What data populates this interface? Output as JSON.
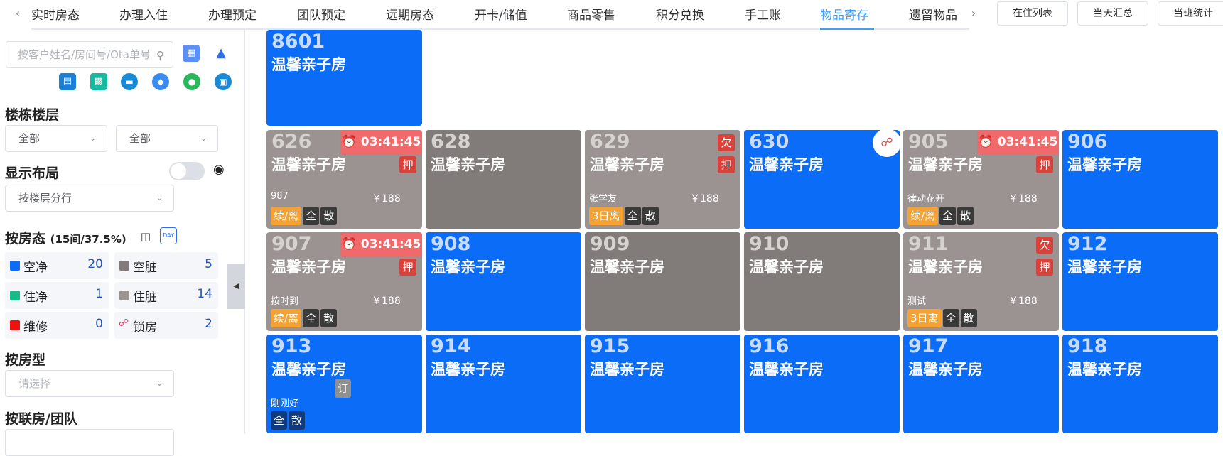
{
  "tabs": {
    "items": [
      "实时房态",
      "办理入住",
      "办理预定",
      "团队预定",
      "远期房态",
      "开卡/储值",
      "商品零售",
      "积分兑换",
      "手工账",
      "物品寄存",
      "遗留物品"
    ],
    "active": "物品寄存",
    "prev_arrow": "‹",
    "next_arrow": "›"
  },
  "header_buttons": [
    "在住列表",
    "当天汇总",
    "当班统计"
  ],
  "sidebar": {
    "search_placeholder": "按客户姓名/房间号/Ota单号",
    "building_title": "楼栋楼层",
    "building_select": "全部",
    "floor_select": "全部",
    "layout_title": "显示布局",
    "layout_select": "按楼层分行",
    "status_title": "按房态",
    "status_summary": "(15间/37.5%)",
    "status_cells": [
      {
        "label": "空净",
        "count": "20",
        "color": "#0b6cf7"
      },
      {
        "label": "空脏",
        "count": "5",
        "color": "#817b7a"
      },
      {
        "label": "住净",
        "count": "1",
        "color": "#1ab98a"
      },
      {
        "label": "住脏",
        "count": "14",
        "color": "#9a9391"
      },
      {
        "label": "维修",
        "count": "0",
        "color": "#ee1111"
      },
      {
        "label": "锁房",
        "count": "2",
        "color": ""
      }
    ],
    "roomtype_title": "按房型",
    "roomtype_placeholder": "请选择",
    "group_title": "按联房/团队"
  },
  "rooms": [
    {
      "number": "8601",
      "type": "温馨亲子房",
      "status": "blue"
    },
    {
      "number": "626",
      "type": "温馨亲子房",
      "status": "occ",
      "timer": "03:41:45",
      "badges": [
        "押"
      ],
      "guest": "987",
      "price": "￥188",
      "chips": [
        "续/离",
        "全",
        "散"
      ]
    },
    {
      "number": "628",
      "type": "温馨亲子房",
      "status": "dirty"
    },
    {
      "number": "629",
      "type": "温馨亲子房",
      "status": "occ",
      "badges": [
        "欠",
        "押"
      ],
      "guest": "张学友",
      "price": "￥188",
      "chips": [
        "3日离",
        "全",
        "散"
      ]
    },
    {
      "number": "630",
      "type": "温馨亲子房",
      "status": "blue",
      "locked": true
    },
    {
      "number": "905",
      "type": "温馨亲子房",
      "status": "occ",
      "timer": "03:41:45",
      "badges": [
        "押"
      ],
      "guest": "律动花开",
      "price": "￥188",
      "chips": [
        "续/离",
        "全",
        "散"
      ]
    },
    {
      "number": "906",
      "type": "温馨亲子房",
      "status": "blue"
    },
    {
      "number": "907",
      "type": "温馨亲子房",
      "status": "occ",
      "timer": "03:41:45",
      "badges": [
        "押"
      ],
      "guest": "按时到",
      "price": "￥188",
      "chips": [
        "续/离",
        "全",
        "散"
      ]
    },
    {
      "number": "908",
      "type": "温馨亲子房",
      "status": "blue"
    },
    {
      "number": "909",
      "type": "温馨亲子房",
      "status": "dirty"
    },
    {
      "number": "910",
      "type": "温馨亲子房",
      "status": "dirty"
    },
    {
      "number": "911",
      "type": "温馨亲子房",
      "status": "occ",
      "badges": [
        "欠",
        "押"
      ],
      "guest": "测试",
      "price": "￥188",
      "chips": [
        "3日离",
        "全",
        "散"
      ]
    },
    {
      "number": "912",
      "type": "温馨亲子房",
      "status": "blue"
    },
    {
      "number": "913",
      "type": "温馨亲子房",
      "status": "blue",
      "booked": "订",
      "guest": "刚刚好",
      "chips": [
        "全",
        "散"
      ]
    },
    {
      "number": "914",
      "type": "温馨亲子房",
      "status": "blue"
    },
    {
      "number": "915",
      "type": "温馨亲子房",
      "status": "blue"
    },
    {
      "number": "916",
      "type": "温馨亲子房",
      "status": "blue"
    },
    {
      "number": "917",
      "type": "温馨亲子房",
      "status": "blue"
    },
    {
      "number": "918",
      "type": "温馨亲子房",
      "status": "blue"
    }
  ]
}
